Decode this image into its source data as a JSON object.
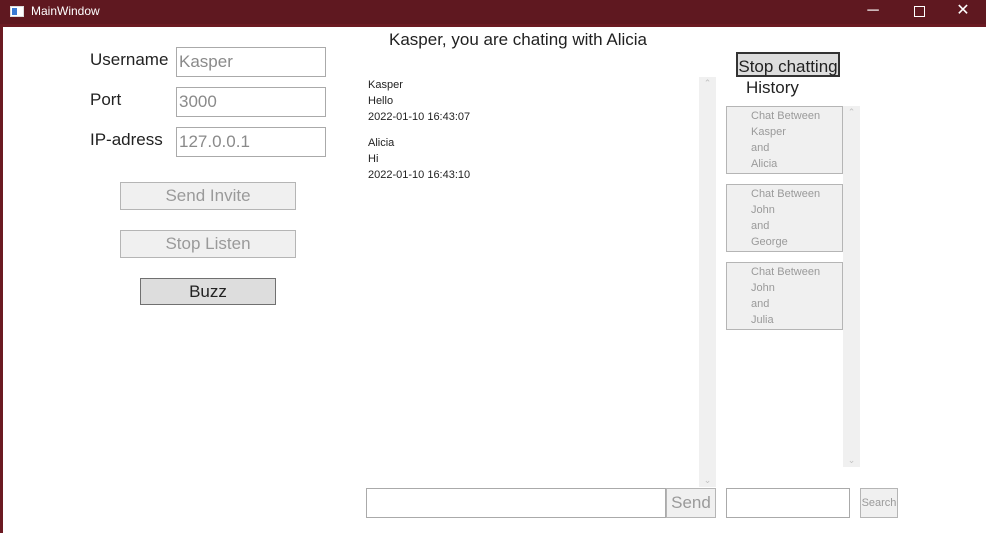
{
  "window": {
    "title": "MainWindow",
    "minimize_glyph": "─",
    "close_glyph": "✕"
  },
  "form": {
    "username_label": "Username",
    "username_value": "Kasper",
    "port_label": "Port",
    "port_value": "3000",
    "ip_label": "IP-adress",
    "ip_value": "127.0.0.1",
    "send_invite": "Send Invite",
    "stop_listen": "Stop Listen",
    "buzz": "Buzz"
  },
  "chat": {
    "title": "Kasper, you are chating with Alicia",
    "messages": [
      {
        "sender": "Kasper",
        "text": "Hello",
        "time": "2022-01-10 16:43:07"
      },
      {
        "sender": "Alicia",
        "text": "Hi",
        "time": "2022-01-10 16:43:10"
      }
    ],
    "input_value": "",
    "send_label": "Send",
    "stop_chatting": "Stop chatting"
  },
  "history": {
    "title": "History",
    "items": [
      {
        "lines": [
          "Chat Between",
          "Kasper",
          "and",
          "Alicia"
        ]
      },
      {
        "lines": [
          "Chat Between",
          "John",
          "and",
          "George"
        ]
      },
      {
        "lines": [
          "Chat Between",
          "John",
          "and",
          "Julia"
        ]
      }
    ],
    "search_value": "",
    "search_label": "Search"
  },
  "icons": {
    "scroll_up": "⌃",
    "scroll_down": "⌄"
  }
}
